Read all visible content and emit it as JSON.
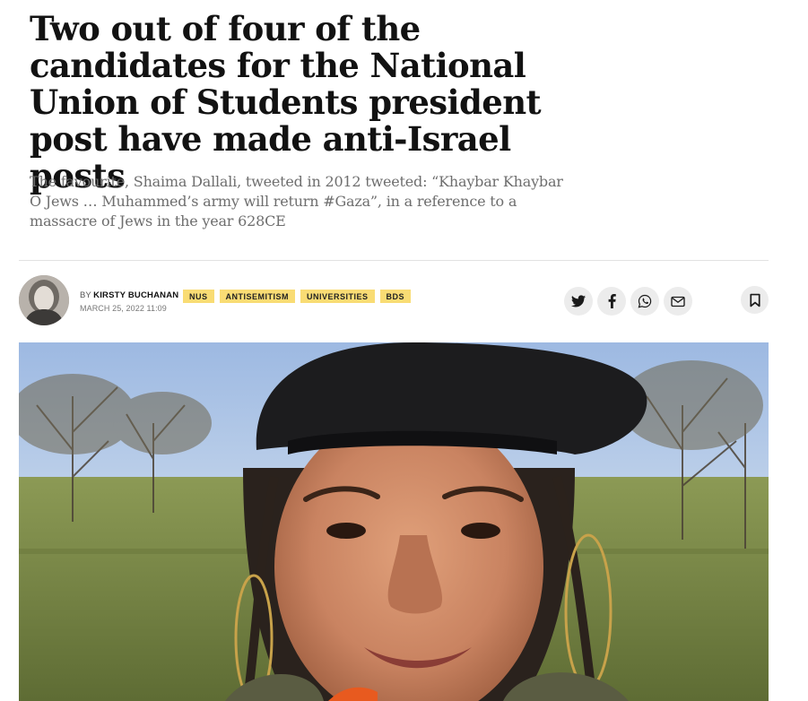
{
  "article": {
    "headline": "Two out of four of the candidates for the National Union of Students president post have made anti-Israel posts",
    "standfirst": "The favourite, Shaima Dallali, tweeted in 2012 tweeted: “Khaybar Khaybar O Jews … Muhammed’s army will return #Gaza”, in a reference to a massacre of Jews in the year 628CE"
  },
  "byline": {
    "prefix": "By",
    "author": "Kirsty Buchanan",
    "date": "March 25, 2022 11:09"
  },
  "tags": [
    "NUS",
    "Antisemitism",
    "Universities",
    "BDS"
  ],
  "share": {
    "icons": [
      "twitter-icon",
      "facebook-icon",
      "whatsapp-icon",
      "email-icon"
    ],
    "bookmark_icon": "bookmark-icon"
  },
  "colors": {
    "tag_background": "#f9dc74",
    "headline": "#121212",
    "standfirst": "#6e6e6e",
    "share_button": "#ececec"
  }
}
